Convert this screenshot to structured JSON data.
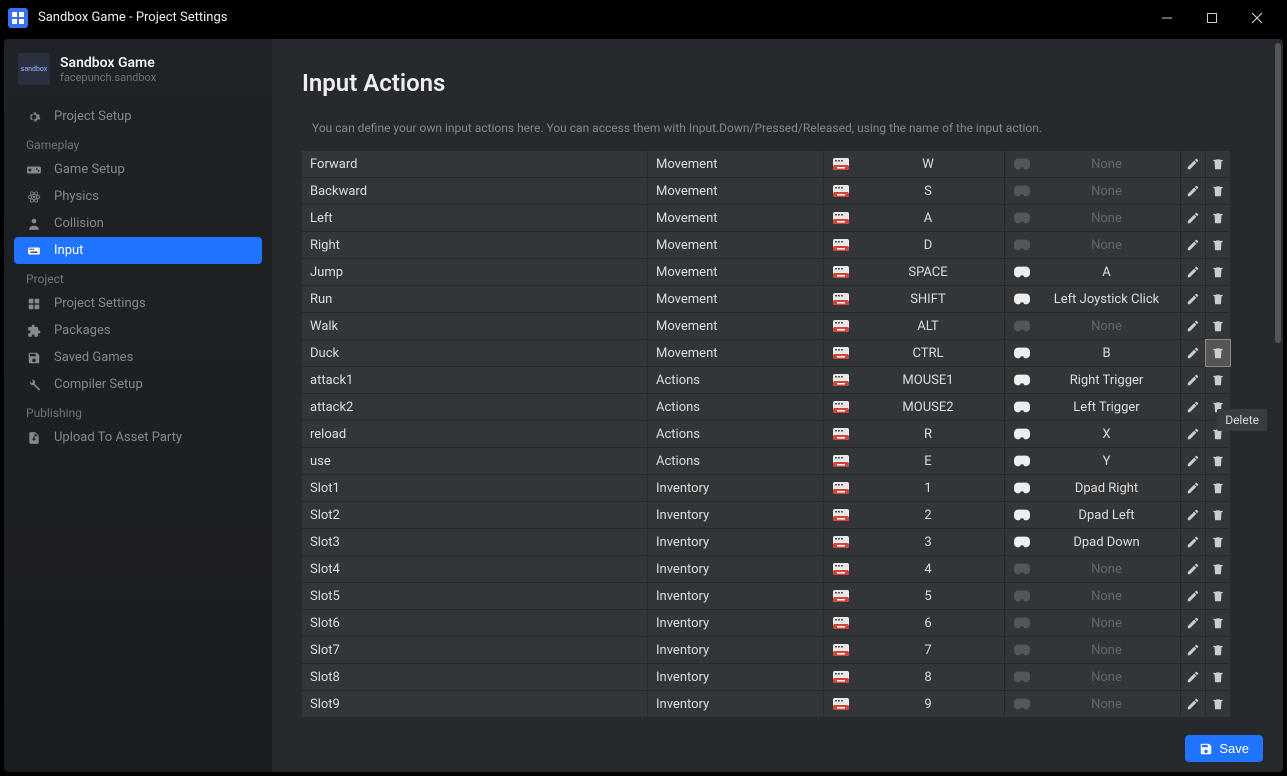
{
  "window": {
    "title": "Sandbox Game - Project Settings"
  },
  "project": {
    "name": "Sandbox Game",
    "ident": "facepunch.sandbox",
    "thumb_label": "sandbox"
  },
  "sidebar": {
    "top": [
      {
        "icon": "gear",
        "label": "Project Setup"
      }
    ],
    "groups": [
      {
        "label": "Gameplay",
        "items": [
          {
            "icon": "gamepad",
            "label": "Game Setup"
          },
          {
            "icon": "atom",
            "label": "Physics"
          },
          {
            "icon": "person",
            "label": "Collision"
          },
          {
            "icon": "keyboard",
            "label": "Input",
            "active": true
          }
        ]
      },
      {
        "label": "Project",
        "items": [
          {
            "icon": "sliders",
            "label": "Project Settings"
          },
          {
            "icon": "puzzle",
            "label": "Packages"
          },
          {
            "icon": "save",
            "label": "Saved Games"
          },
          {
            "icon": "tools",
            "label": "Compiler Setup"
          }
        ]
      },
      {
        "label": "Publishing",
        "items": [
          {
            "icon": "upload",
            "label": "Upload To Asset Party"
          }
        ]
      }
    ]
  },
  "page": {
    "title": "Input Actions",
    "description": "You can define your own input actions here. You can access them with Input.Down/Pressed/Released, using the name of the input action."
  },
  "actions": [
    {
      "name": "Forward",
      "group": "Movement",
      "kb": "W",
      "gp": "None"
    },
    {
      "name": "Backward",
      "group": "Movement",
      "kb": "S",
      "gp": "None"
    },
    {
      "name": "Left",
      "group": "Movement",
      "kb": "A",
      "gp": "None"
    },
    {
      "name": "Right",
      "group": "Movement",
      "kb": "D",
      "gp": "None"
    },
    {
      "name": "Jump",
      "group": "Movement",
      "kb": "SPACE",
      "gp": "A"
    },
    {
      "name": "Run",
      "group": "Movement",
      "kb": "SHIFT",
      "gp": "Left Joystick Click"
    },
    {
      "name": "Walk",
      "group": "Movement",
      "kb": "ALT",
      "gp": "None"
    },
    {
      "name": "Duck",
      "group": "Movement",
      "kb": "CTRL",
      "gp": "B",
      "delete_highlight": true
    },
    {
      "name": "attack1",
      "group": "Actions",
      "kb": "MOUSE1",
      "gp": "Right Trigger"
    },
    {
      "name": "attack2",
      "group": "Actions",
      "kb": "MOUSE2",
      "gp": "Left Trigger"
    },
    {
      "name": "reload",
      "group": "Actions",
      "kb": "R",
      "gp": "X"
    },
    {
      "name": "use",
      "group": "Actions",
      "kb": "E",
      "gp": "Y"
    },
    {
      "name": "Slot1",
      "group": "Inventory",
      "kb": "1",
      "gp": "Dpad Right"
    },
    {
      "name": "Slot2",
      "group": "Inventory",
      "kb": "2",
      "gp": "Dpad Left"
    },
    {
      "name": "Slot3",
      "group": "Inventory",
      "kb": "3",
      "gp": "Dpad Down"
    },
    {
      "name": "Slot4",
      "group": "Inventory",
      "kb": "4",
      "gp": "None"
    },
    {
      "name": "Slot5",
      "group": "Inventory",
      "kb": "5",
      "gp": "None"
    },
    {
      "name": "Slot6",
      "group": "Inventory",
      "kb": "6",
      "gp": "None"
    },
    {
      "name": "Slot7",
      "group": "Inventory",
      "kb": "7",
      "gp": "None"
    },
    {
      "name": "Slot8",
      "group": "Inventory",
      "kb": "8",
      "gp": "None"
    },
    {
      "name": "Slot9",
      "group": "Inventory",
      "kb": "9",
      "gp": "None"
    }
  ],
  "tooltip": "Delete",
  "footer": {
    "save_label": "Save"
  }
}
